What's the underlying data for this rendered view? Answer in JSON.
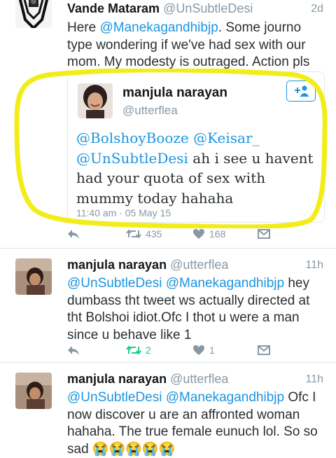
{
  "colors": {
    "link": "#1b95e0",
    "retweeted": "#19cf86",
    "highlight": "#f2ed1a",
    "secondary": "#8899a6"
  },
  "tweet1": {
    "display_name": "Vande Mataram",
    "handle": "@UnSubtleDesi",
    "time": "2d",
    "text_before": "Here ",
    "mention": "@Manekagandhibjp",
    "text_after": ". Some journo type wondering if we've had sex with our mom. My modesty is outraged. Action pls",
    "quoted": {
      "display_name": "manjula narayan",
      "handle": "@utterflea",
      "mention1": "@BolshoyBooze",
      "mention2": "@Keisar_",
      "mention3": "@UnSubtleDesi",
      "text": " ah i see u havent had your quota of sex with mummy today hahaha",
      "timestamp": "11:40 am · 05 May 15",
      "follow_icon": "add-user-icon"
    },
    "retweets": "435",
    "likes": "168"
  },
  "tweet2": {
    "display_name": "manjula narayan",
    "handle": "@utterflea",
    "time": "11h",
    "mention1": "@UnSubtleDesi",
    "mention2": "@Manekagandhibjp",
    "text": " hey dumbass tht tweet ws actually directed at tht Bolshoi idiot.Ofc I thot u were a man since u behave like 1",
    "retweets": "2",
    "likes": "1"
  },
  "tweet3": {
    "display_name": "manjula narayan",
    "handle": "@utterflea",
    "time": "11h",
    "mention1": "@UnSubtleDesi",
    "mention2": "@Manekagandhibjp",
    "text": " Ofc I now discover u are an affronted woman hahaha. The true female eunuch lol. So so sad ",
    "emojis": "😭😭😭😭😭"
  }
}
